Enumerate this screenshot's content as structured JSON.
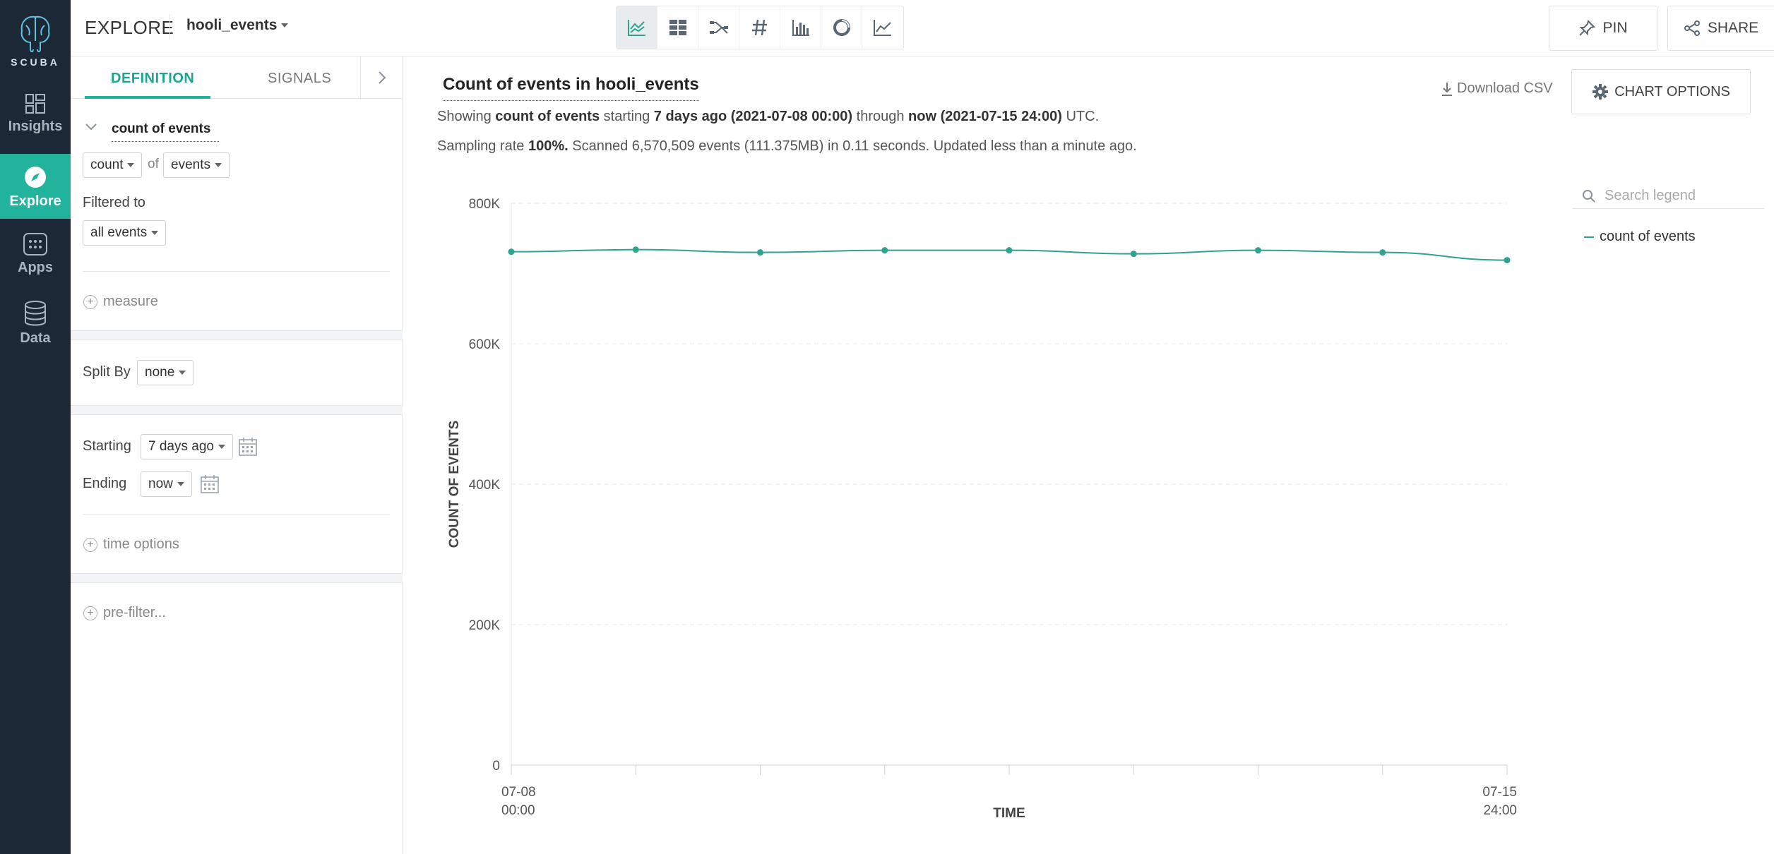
{
  "app": {
    "logo_text": "SCUBA",
    "accent": "#21b39b",
    "nav": [
      {
        "label": "Insights",
        "icon": "insights-icon",
        "active": false
      },
      {
        "label": "Explore",
        "icon": "compass-icon",
        "active": true
      },
      {
        "label": "Apps",
        "icon": "apps-grid-icon",
        "active": false
      },
      {
        "label": "Data",
        "icon": "database-icon",
        "active": false
      }
    ]
  },
  "header": {
    "section_title": "EXPLORE",
    "dataset": "hooli_events",
    "viz_tabs": [
      {
        "icon": "timeseries-chart-icon",
        "active": true
      },
      {
        "icon": "table-icon",
        "active": false
      },
      {
        "icon": "flow-icon",
        "active": false
      },
      {
        "icon": "number-hash-icon",
        "active": false
      },
      {
        "icon": "bar-chart-icon",
        "active": false
      },
      {
        "icon": "donut-chart-icon",
        "active": false
      },
      {
        "icon": "line-chart-icon",
        "active": false
      }
    ],
    "pin_label": "PIN",
    "share_label": "SHARE"
  },
  "panel": {
    "tab_definition": "DEFINITION",
    "tab_signals": "SIGNALS",
    "measure_name": "count of events",
    "aggregation": "count",
    "of_label": "of",
    "target": "events",
    "filtered_to_label": "Filtered to",
    "filter_value": "all events",
    "add_measure": "measure",
    "split_by_label": "Split By",
    "split_by_value": "none",
    "starting_label": "Starting",
    "starting_value": "7 days ago",
    "ending_label": "Ending",
    "ending_value": "now",
    "time_options": "time options",
    "pre_filter": "pre-filter..."
  },
  "main": {
    "chart_title": "Count of events in hooli_events",
    "download_csv": "Download CSV",
    "chart_options": "CHART OPTIONS",
    "summary1": {
      "showing": "Showing",
      "measure": "count of events",
      "starting": "starting",
      "start_rel": "7 days ago (2021-07-08 00:00)",
      "through": "through",
      "end_rel": "now (2021-07-15 24:00)",
      "tz": "UTC."
    },
    "summary2": {
      "sampling_prefix": "Sampling rate",
      "sampling_rate": "100%.",
      "rest": "Scanned 6,570,509 events (111.375MB) in 0.11 seconds. Updated less than a minute ago."
    },
    "legend_search_placeholder": "Search legend",
    "legend": [
      {
        "name": "count of events",
        "color": "#2ea38e"
      }
    ]
  },
  "chart_data": {
    "type": "line",
    "title": "Count of events in hooli_events",
    "xlabel": "TIME",
    "ylabel": "COUNT OF EVENTS",
    "ylim": [
      0,
      800000
    ],
    "y_ticks": [
      "0",
      "200K",
      "400K",
      "600K",
      "800K"
    ],
    "x_tick_labels": [
      {
        "line1": "07-08",
        "line2": "00:00"
      },
      {
        "line1": "07-15",
        "line2": "24:00"
      }
    ],
    "x": [
      "2021-07-08 00:00",
      "2021-07-08 21:20",
      "2021-07-09 18:40",
      "2021-07-10 16:00",
      "2021-07-11 13:20",
      "2021-07-12 10:40",
      "2021-07-13 08:00",
      "2021-07-14 05:20",
      "2021-07-15 02:40"
    ],
    "series": [
      {
        "name": "count of events",
        "color": "#2ea38e",
        "values": [
          731000,
          734000,
          730000,
          733000,
          733000,
          728000,
          733000,
          730000,
          719000
        ]
      }
    ],
    "grid": true,
    "legend": "right"
  }
}
